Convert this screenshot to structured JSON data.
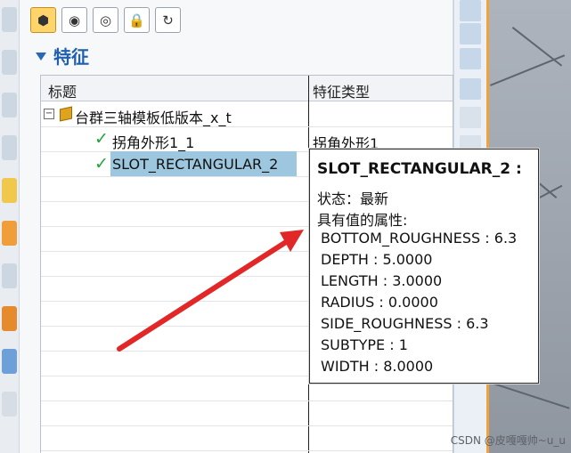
{
  "section_title": "特征",
  "table": {
    "headers": {
      "title": "标题",
      "type": "特征类型"
    },
    "rows": [
      {
        "title": "台群三轴模板低版本_x_t",
        "type": ""
      },
      {
        "title": "拐角外形1_1",
        "type": "拐角外形1"
      },
      {
        "title": "SLOT_RECTANGULAR_2",
        "type": ""
      }
    ]
  },
  "tooltip": {
    "title": "SLOT_RECTANGULAR_2 :",
    "status": "状态：最新",
    "attrs_heading": "具有值的属性:",
    "attributes": [
      "BOTTOM_ROUGHNESS : 6.3",
      "DEPTH : 5.0000",
      "LENGTH : 3.0000",
      "RADIUS : 0.0000",
      "SIDE_ROUGHNESS : 6.3",
      "SUBTYPE : 1",
      "WIDTH : 8.0000"
    ]
  },
  "watermark": "CSDN @皮嘎嘎帅~u_u",
  "icons": {
    "toolbar": [
      "solid-icon",
      "view-icon",
      "axis-view-icon",
      "lock-icon",
      "refresh-icon"
    ],
    "tree": [
      "minus-expand-icon",
      "part-cube-icon",
      "checkmark-icon",
      "checkmark-icon"
    ]
  },
  "colors": {
    "selected_row": "#9dc7df",
    "accent_blue": "#1f5fae",
    "check_green": "#23a43a",
    "arrow_red": "#e12727"
  }
}
